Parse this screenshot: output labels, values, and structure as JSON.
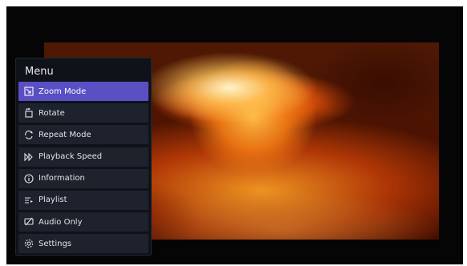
{
  "menu": {
    "title": "Menu",
    "items": [
      {
        "label": "Zoom Mode",
        "icon": "zoom-mode-icon",
        "active": true
      },
      {
        "label": "Rotate",
        "icon": "rotate-icon",
        "active": false
      },
      {
        "label": "Repeat Mode",
        "icon": "repeat-icon",
        "active": false
      },
      {
        "label": "Playback Speed",
        "icon": "playback-speed-icon",
        "active": false
      },
      {
        "label": "Information",
        "icon": "info-icon",
        "active": false
      },
      {
        "label": "Playlist",
        "icon": "playlist-icon",
        "active": false
      },
      {
        "label": "Audio Only",
        "icon": "audio-only-icon",
        "active": false
      },
      {
        "label": "Settings",
        "icon": "settings-icon",
        "active": false
      }
    ]
  },
  "colors": {
    "menu_background": "#0f1219",
    "item_background": "#1d222c",
    "active_item": "#5b4fc4",
    "text": "#e2e4ea"
  }
}
